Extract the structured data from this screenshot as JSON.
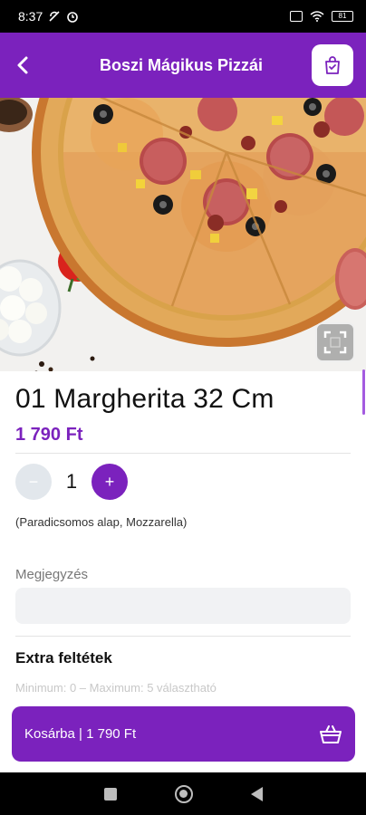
{
  "status_bar": {
    "time": "8:37",
    "battery": "81"
  },
  "app_bar": {
    "title": "Boszi Mágikus Pizzái"
  },
  "product": {
    "title": "01 Margherita 32 Cm",
    "price": "1 790 Ft",
    "ingredients": "(Paradicsomos alap, Mozzarella)"
  },
  "quantity": {
    "minus_label": "−",
    "value": "1",
    "plus_label": "+"
  },
  "note": {
    "label": "Megjegyzés",
    "value": "",
    "placeholder": ""
  },
  "extras": {
    "title": "Extra feltétek",
    "subtitle": "Minimum: 0 – Maximum: 5 választható"
  },
  "cart_button": {
    "label": "Kosárba | 1 790 Ft"
  },
  "colors": {
    "accent": "#7b22bd",
    "minus_bg": "#e2e7ec",
    "input_bg": "#f1f2f4"
  },
  "icons": {
    "back": "arrow-left-icon",
    "cart": "shopping-bag-icon",
    "expand": "fullscreen-icon",
    "basket": "basket-icon"
  }
}
